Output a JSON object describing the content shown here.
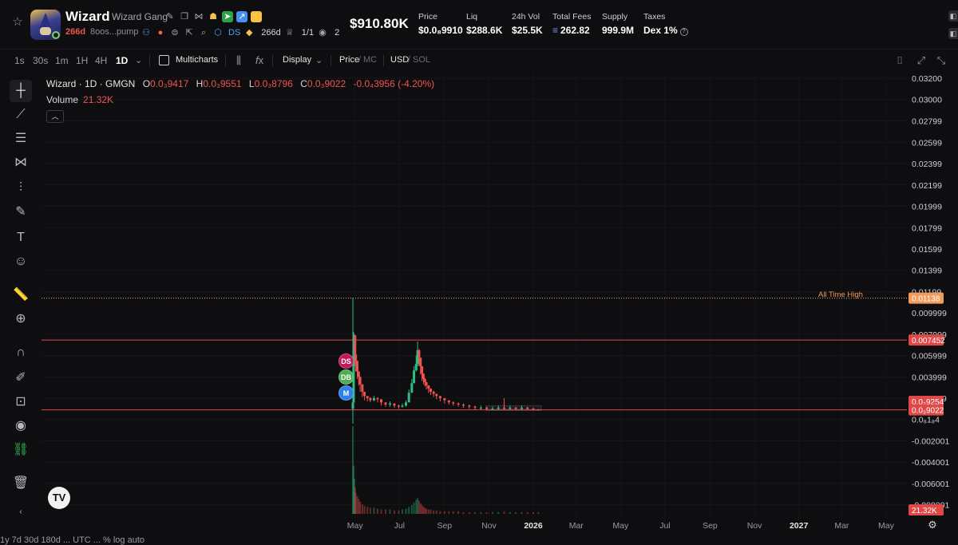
{
  "token": {
    "name": "Wizard",
    "full_name": "Wizard Gang",
    "age": "266d",
    "address": "8oos...pump",
    "dex_age": "266d",
    "ds_tag": "DS",
    "insiders": "1/1",
    "watchers": "2"
  },
  "market_cap": "$910.80K",
  "metrics": [
    {
      "label": "Price",
      "value": "$0.0₈9910"
    },
    {
      "label": "Liq",
      "value": "$288.6K"
    },
    {
      "label": "24h Vol",
      "value": "$25.5K"
    },
    {
      "label": "Total Fees",
      "value": "262.82"
    },
    {
      "label": "Supply",
      "value": "999.9M"
    },
    {
      "label": "Taxes",
      "value": "Dex 1%"
    }
  ],
  "timeframes": [
    "1s",
    "30s",
    "1m",
    "1H",
    "4H",
    "1D"
  ],
  "active_timeframe": "1D",
  "toolbar": {
    "multicharts": "Multicharts",
    "display": "Display",
    "price": "Price",
    "mc": "MC",
    "usd": "USD",
    "sol": "SOL"
  },
  "legend": {
    "symbol": "Wizard · 1D · GMGN",
    "open": "0.0₃9417",
    "high": "0.0₃9551",
    "low": "0.0₃8796",
    "close": "0.0₃9022",
    "change": "-0.0₄3956 (-4.20%)",
    "volume_label": "Volume",
    "volume_value": "21.32K"
  },
  "ath_label": "All Time High",
  "markers": [
    {
      "label": "DS",
      "color": "#c2185b"
    },
    {
      "label": "DB",
      "color": "#4caf50"
    },
    {
      "label": "M",
      "color": "#2f80ed"
    }
  ],
  "price_axis_ticks": [
    "0.03200",
    "0.03000",
    "0.02799",
    "0.02599",
    "0.02399",
    "0.02199",
    "0.01999",
    "0.01799",
    "0.01599",
    "0.01399",
    "0.01199",
    "0.009999",
    "0.007999",
    "0.005999",
    "0.003999",
    "0.001999",
    "0.0₈1₈4",
    "-0.002001",
    "-0.004001",
    "-0.006001",
    "-0.008001"
  ],
  "price_badges": [
    {
      "text": "0.01138",
      "color": "#f29b5b"
    },
    {
      "text": "0.007452",
      "color": "#e04848"
    },
    {
      "text": "0.0₃9254",
      "color": "#e04848"
    },
    {
      "text": "0.0₃9022",
      "color": "#e04848"
    },
    {
      "text": "21.32K",
      "color": "#e04848"
    }
  ],
  "time_labels": [
    "May",
    "Jul",
    "Sep",
    "Nov",
    "2026",
    "Mar",
    "May",
    "Jul",
    "Sep",
    "Nov",
    "2027",
    "Mar",
    "May"
  ],
  "footer": "1y 7d 30d 180d ... UTC ... % log auto",
  "chart_data": {
    "type": "candlestick",
    "title": "Wizard · 1D · GMGN",
    "ylim": [
      -0.009,
      0.032
    ],
    "x": [
      "2025-04-28",
      "2025-04-29",
      "2025-04-30",
      "2025-05-01",
      "2025-05-02",
      "2025-05-04",
      "2025-05-06",
      "2025-05-08",
      "2025-05-11",
      "2025-05-14",
      "2025-05-18",
      "2025-05-22",
      "2025-05-27",
      "2025-06-01",
      "2025-06-06",
      "2025-06-12",
      "2025-06-18",
      "2025-06-24",
      "2025-06-30",
      "2025-07-05",
      "2025-07-10",
      "2025-07-14",
      "2025-07-18",
      "2025-07-21",
      "2025-07-24",
      "2025-07-26",
      "2025-07-28",
      "2025-07-30",
      "2025-08-01",
      "2025-08-03",
      "2025-08-05",
      "2025-08-07",
      "2025-08-10",
      "2025-08-13",
      "2025-08-17",
      "2025-08-21",
      "2025-08-26",
      "2025-09-01",
      "2025-09-07",
      "2025-09-13",
      "2025-09-20",
      "2025-09-27",
      "2025-10-05",
      "2025-10-13",
      "2025-10-21",
      "2025-10-29",
      "2025-11-06",
      "2025-11-14",
      "2025-11-22",
      "2025-11-30",
      "2025-12-08",
      "2025-12-16",
      "2025-12-24",
      "2026-01-01",
      "2026-01-08"
    ],
    "close": [
      0.0016,
      0.0065,
      0.0079,
      0.0061,
      0.0055,
      0.0045,
      0.004,
      0.0033,
      0.0026,
      0.0022,
      0.002,
      0.0018,
      0.002,
      0.0019,
      0.0016,
      0.0014,
      0.0015,
      0.0013,
      0.0012,
      0.0013,
      0.0016,
      0.0025,
      0.0034,
      0.0046,
      0.0052,
      0.0065,
      0.0058,
      0.005,
      0.0043,
      0.0038,
      0.0035,
      0.0032,
      0.0029,
      0.0026,
      0.0024,
      0.0022,
      0.002,
      0.0018,
      0.0016,
      0.0015,
      0.0014,
      0.0013,
      0.0012,
      0.0011,
      0.0011,
      0.001,
      0.001,
      0.0011,
      0.001,
      0.0011,
      0.001,
      0.0011,
      0.001,
      0.00095,
      0.0009
    ],
    "high": [
      0.0114,
      0.0082,
      0.008,
      0.007,
      0.006,
      0.005,
      0.0045,
      0.0036,
      0.0029,
      0.0025,
      0.0022,
      0.0021,
      0.0022,
      0.0021,
      0.0018,
      0.0016,
      0.0017,
      0.0015,
      0.0014,
      0.0015,
      0.0018,
      0.0028,
      0.0038,
      0.005,
      0.006,
      0.0073,
      0.0066,
      0.0057,
      0.0048,
      0.0042,
      0.0039,
      0.0035,
      0.0032,
      0.0029,
      0.0027,
      0.0024,
      0.0022,
      0.002,
      0.0018,
      0.0017,
      0.0016,
      0.0015,
      0.0014,
      0.0013,
      0.0013,
      0.0012,
      0.0012,
      0.0013,
      0.002,
      0.0013,
      0.0012,
      0.0013,
      0.0012,
      0.0011,
      0.00096
    ],
    "low": [
      -0.0004,
      0.0016,
      0.0055,
      0.005,
      0.0045,
      0.0038,
      0.0032,
      0.0026,
      0.0021,
      0.0018,
      0.0017,
      0.0016,
      0.0017,
      0.0016,
      0.0013,
      0.0012,
      0.0012,
      0.0011,
      0.001,
      0.0011,
      0.0012,
      0.0016,
      0.0025,
      0.0034,
      0.0045,
      0.005,
      0.005,
      0.0042,
      0.0036,
      0.0033,
      0.0031,
      0.0028,
      0.0025,
      0.0023,
      0.0021,
      0.0019,
      0.0017,
      0.0015,
      0.0014,
      0.0013,
      0.0012,
      0.0011,
      0.001,
      0.0009,
      0.0009,
      0.0009,
      0.0009,
      0.0009,
      0.0009,
      0.0009,
      0.0009,
      0.0009,
      0.0009,
      0.00088,
      0.00088
    ],
    "open": [
      0.001,
      0.0016,
      0.0065,
      0.0079,
      0.0061,
      0.0055,
      0.0045,
      0.004,
      0.0033,
      0.0026,
      0.0022,
      0.002,
      0.0018,
      0.002,
      0.0019,
      0.0016,
      0.0014,
      0.0015,
      0.0013,
      0.0012,
      0.0013,
      0.0016,
      0.0025,
      0.0034,
      0.0046,
      0.0052,
      0.0065,
      0.0058,
      0.005,
      0.0043,
      0.0038,
      0.0035,
      0.0032,
      0.0029,
      0.0026,
      0.0024,
      0.0022,
      0.002,
      0.0018,
      0.0016,
      0.0015,
      0.0014,
      0.0013,
      0.0012,
      0.0011,
      0.0011,
      0.001,
      0.001,
      0.0011,
      0.001,
      0.0011,
      0.001,
      0.0011,
      0.001,
      0.00094
    ],
    "volume_relative": [
      1.0,
      0.55,
      0.4,
      0.3,
      0.24,
      0.2,
      0.17,
      0.14,
      0.11,
      0.09,
      0.08,
      0.07,
      0.07,
      0.06,
      0.05,
      0.05,
      0.05,
      0.04,
      0.04,
      0.05,
      0.06,
      0.08,
      0.1,
      0.13,
      0.16,
      0.18,
      0.15,
      0.12,
      0.1,
      0.08,
      0.07,
      0.06,
      0.05,
      0.05,
      0.04,
      0.04,
      0.03,
      0.03,
      0.03,
      0.03,
      0.03,
      0.02,
      0.02,
      0.02,
      0.02,
      0.02,
      0.02,
      0.02,
      0.03,
      0.02,
      0.02,
      0.02,
      0.02,
      0.02,
      0.02
    ],
    "horizontal_lines": [
      {
        "value": 0.01138,
        "style": "dotted",
        "color": "#f29b5b"
      },
      {
        "value": 0.007452,
        "style": "solid",
        "color": "#e04848"
      },
      {
        "value": 0.0009022,
        "style": "solid",
        "color": "#e04848"
      }
    ],
    "up_color": "#2ebd85",
    "down_color": "#f0544f"
  }
}
